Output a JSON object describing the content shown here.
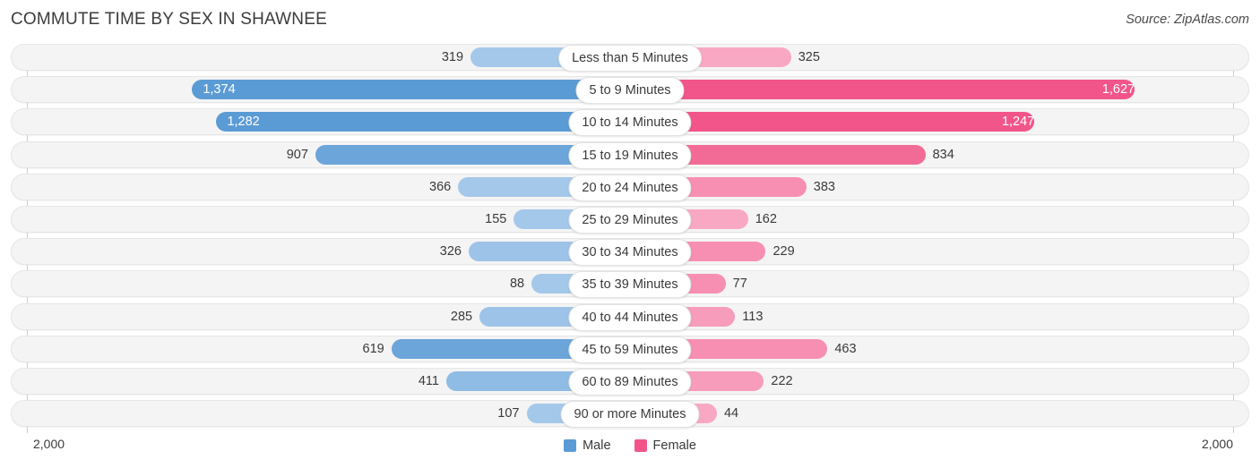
{
  "header": {
    "title": "COMMUTE TIME BY SEX IN SHAWNEE",
    "source": "Source: ZipAtlas.com"
  },
  "axis": {
    "left_tick": "2,000",
    "right_tick": "2,000"
  },
  "legend": {
    "items": [
      {
        "label": "Male",
        "color": "#5b9bd5"
      },
      {
        "label": "Female",
        "color": "#f2558a"
      }
    ]
  },
  "colors": {
    "male_strong": "#5b9bd5",
    "male_light": "#a4c8ea",
    "female_strong": "#f2558a",
    "female_light": "#f9a8c3",
    "female_mid": "#f26b96",
    "track_fill": "#f4f4f4",
    "track_border": "#e6e6e6"
  },
  "chart_data": {
    "type": "bar",
    "subtype": "diverging-bidirectional",
    "title": "COMMUTE TIME BY SEX IN SHAWNEE",
    "xlabel": "",
    "ylabel": "",
    "axis_max": 2000,
    "axis_min": 0,
    "grid": false,
    "legend_position": "bottom-center",
    "categories": [
      "Less than 5 Minutes",
      "5 to 9 Minutes",
      "10 to 14 Minutes",
      "15 to 19 Minutes",
      "20 to 24 Minutes",
      "25 to 29 Minutes",
      "30 to 34 Minutes",
      "35 to 39 Minutes",
      "40 to 44 Minutes",
      "45 to 59 Minutes",
      "60 to 89 Minutes",
      "90 or more Minutes"
    ],
    "series": [
      {
        "name": "Male",
        "direction": "left",
        "values": [
          319,
          1374,
          1282,
          907,
          366,
          155,
          326,
          88,
          285,
          619,
          411,
          107
        ],
        "labels": [
          "319",
          "1,374",
          "1,282",
          "907",
          "366",
          "155",
          "326",
          "88",
          "285",
          "619",
          "411",
          "107"
        ]
      },
      {
        "name": "Female",
        "direction": "right",
        "values": [
          325,
          1627,
          1247,
          834,
          383,
          162,
          229,
          77,
          113,
          463,
          222,
          44
        ],
        "labels": [
          "325",
          "1,627",
          "1,247",
          "834",
          "383",
          "162",
          "229",
          "77",
          "113",
          "463",
          "222",
          "44"
        ]
      }
    ],
    "rows": [
      {
        "category": "Less than 5 Minutes",
        "male": 319,
        "male_label": "319",
        "male_color": "#a4c8ea",
        "male_label_inside": false,
        "female": 325,
        "female_label": "325",
        "female_color": "#f9a8c3",
        "female_label_inside": false
      },
      {
        "category": "5 to 9 Minutes",
        "male": 1374,
        "male_label": "1,374",
        "male_color": "#5b9bd5",
        "male_label_inside": true,
        "female": 1627,
        "female_label": "1,627",
        "female_color": "#f2558a",
        "female_label_inside": true
      },
      {
        "category": "10 to 14 Minutes",
        "male": 1282,
        "male_label": "1,282",
        "male_color": "#5b9bd5",
        "male_label_inside": true,
        "female": 1247,
        "female_label": "1,247",
        "female_color": "#f2558a",
        "female_label_inside": true
      },
      {
        "category": "15 to 19 Minutes",
        "male": 907,
        "male_label": "907",
        "male_color": "#6ba5d9",
        "male_label_inside": false,
        "female": 834,
        "female_label": "834",
        "female_color": "#f26b96",
        "female_label_inside": false
      },
      {
        "category": "20 to 24 Minutes",
        "male": 366,
        "male_label": "366",
        "male_color": "#a4c8ea",
        "male_label_inside": false,
        "female": 383,
        "female_label": "383",
        "female_color": "#f78fb3",
        "female_label_inside": false
      },
      {
        "category": "25 to 29 Minutes",
        "male": 155,
        "male_label": "155",
        "male_color": "#a4c8ea",
        "male_label_inside": false,
        "female": 162,
        "female_label": "162",
        "female_color": "#f9a8c3",
        "female_label_inside": false
      },
      {
        "category": "30 to 34 Minutes",
        "male": 326,
        "male_label": "326",
        "male_color": "#9ec3e8",
        "male_label_inside": false,
        "female": 229,
        "female_label": "229",
        "female_color": "#f78fb3",
        "female_label_inside": false
      },
      {
        "category": "35 to 39 Minutes",
        "male": 88,
        "male_label": "88",
        "male_color": "#a4c8ea",
        "male_label_inside": false,
        "female": 77,
        "female_label": "77",
        "female_color": "#f78fb3",
        "female_label_inside": false
      },
      {
        "category": "40 to 44 Minutes",
        "male": 285,
        "male_label": "285",
        "male_color": "#9ec3e8",
        "male_label_inside": false,
        "female": 113,
        "female_label": "113",
        "female_color": "#f79cbb",
        "female_label_inside": false
      },
      {
        "category": "45 to 59 Minutes",
        "male": 619,
        "male_label": "619",
        "male_color": "#6ba5d9",
        "male_label_inside": false,
        "female": 463,
        "female_label": "463",
        "female_color": "#f78fb3",
        "female_label_inside": false
      },
      {
        "category": "60 to 89 Minutes",
        "male": 411,
        "male_label": "411",
        "male_color": "#8fbce5",
        "male_label_inside": false,
        "female": 222,
        "female_label": "222",
        "female_color": "#f79cbb",
        "female_label_inside": false
      },
      {
        "category": "90 or more Minutes",
        "male": 107,
        "male_label": "107",
        "male_color": "#a4c8ea",
        "male_label_inside": false,
        "female": 44,
        "female_label": "44",
        "female_color": "#f9a8c3",
        "female_label_inside": false
      }
    ]
  }
}
